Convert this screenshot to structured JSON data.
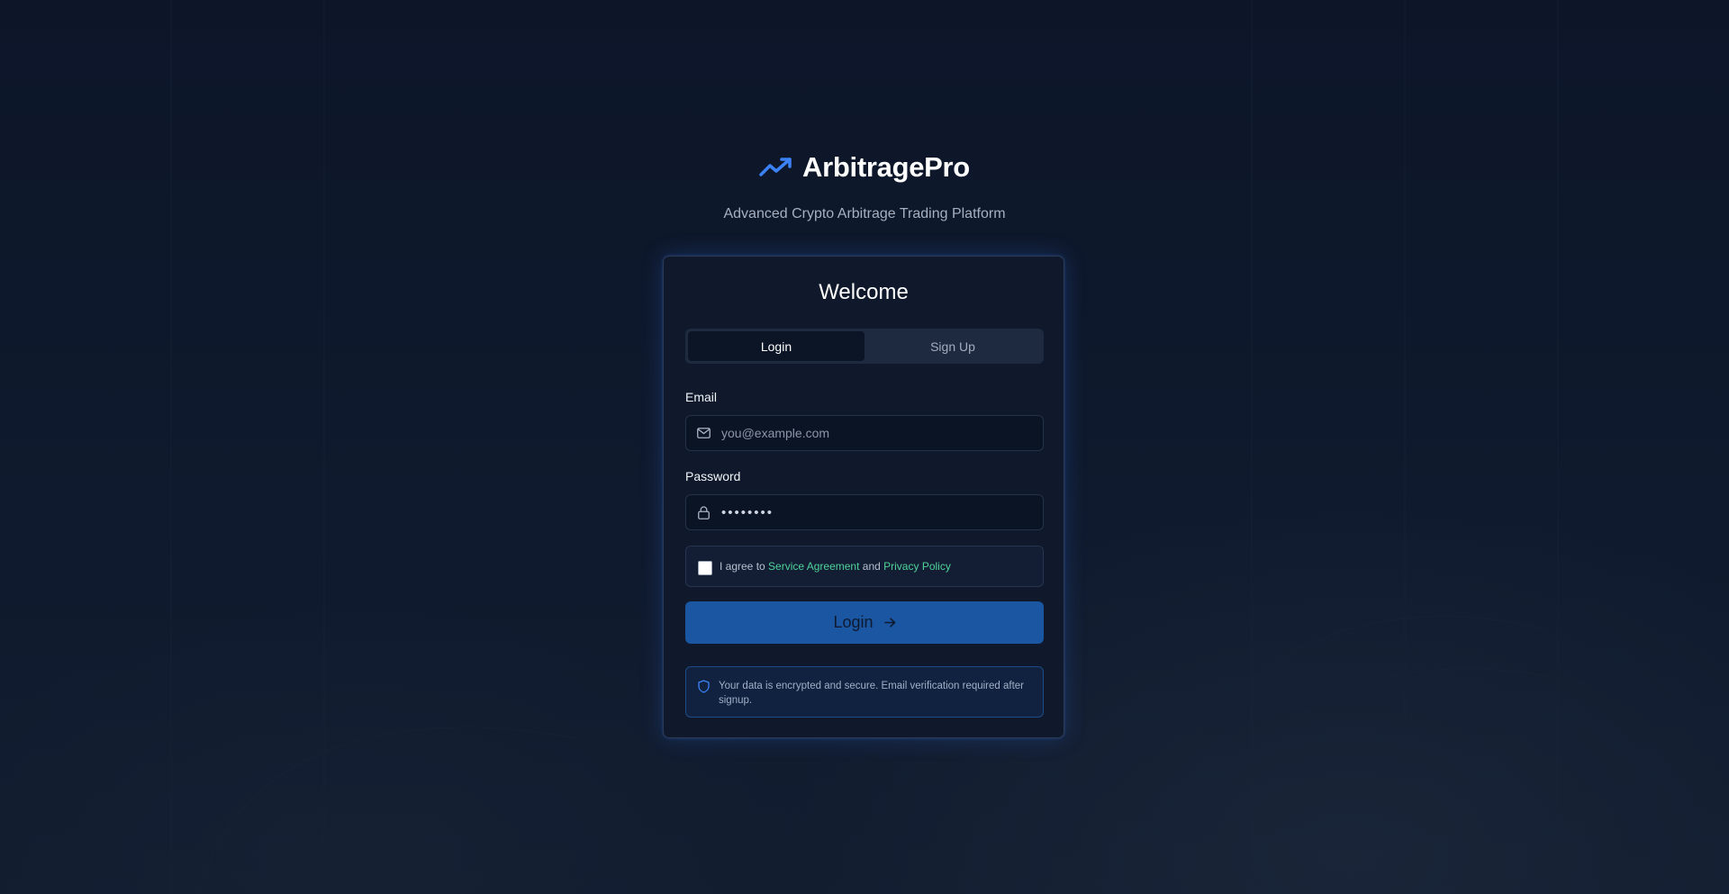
{
  "brand": {
    "name": "ArbitragePro",
    "tagline": "Advanced Crypto Arbitrage Trading Platform",
    "icon": "trending-up-icon",
    "accent_color": "#3b82f6"
  },
  "card": {
    "title": "Welcome",
    "tabs": [
      {
        "label": "Login",
        "active": true
      },
      {
        "label": "Sign Up",
        "active": false
      }
    ],
    "email": {
      "label": "Email",
      "placeholder": "you@example.com",
      "value": ""
    },
    "password": {
      "label": "Password",
      "value": "••••••••"
    },
    "agreement": {
      "checked": false,
      "prefix": "I agree to ",
      "link1": "Service Agreement",
      "middle": " and ",
      "link2": "Privacy Policy",
      "link_color": "#4ed39a"
    },
    "submit_label": "Login",
    "notice": "Your data is encrypted and secure. Email verification required after signup."
  }
}
